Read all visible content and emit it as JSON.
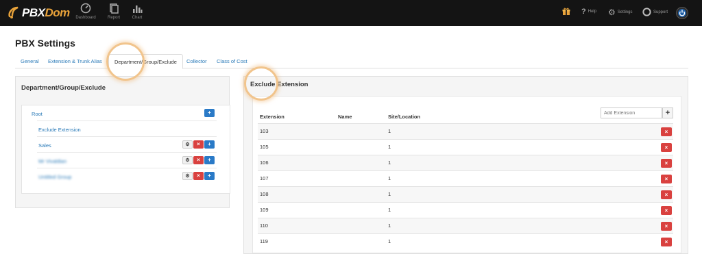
{
  "brand": {
    "prefix": "PBX",
    "suffix": "Dom"
  },
  "nav": {
    "dashboard": "Dashboard",
    "report": "Report",
    "chart": "Chart",
    "help": "Help",
    "settings": "Settings",
    "support": "Support"
  },
  "page_title": "PBX Settings",
  "tabs": [
    {
      "label": "General"
    },
    {
      "label": "Extension & Trunk Alias"
    },
    {
      "label": "Department/Group/Exclude",
      "active": true
    },
    {
      "label": "Collector"
    },
    {
      "label": "Class of Cost"
    }
  ],
  "left_panel": {
    "title": "Department/Group/Exclude",
    "tree": {
      "root": "Root",
      "children": [
        "Exclude Extension",
        "Sales",
        "Mr Vivaldian",
        "Untitled Group"
      ]
    }
  },
  "right_panel": {
    "title": "Exclude Extension",
    "columns": [
      "Extension",
      "Name",
      "Site/Location"
    ],
    "add_placeholder": "Add Extension",
    "rows": [
      {
        "extension": "103",
        "name": "",
        "site": "1"
      },
      {
        "extension": "105",
        "name": "",
        "site": "1"
      },
      {
        "extension": "106",
        "name": "",
        "site": "1"
      },
      {
        "extension": "107",
        "name": "",
        "site": "1"
      },
      {
        "extension": "108",
        "name": "",
        "site": "1"
      },
      {
        "extension": "109",
        "name": "",
        "site": "1"
      },
      {
        "extension": "110",
        "name": "",
        "site": "1"
      },
      {
        "extension": "119",
        "name": "",
        "site": "1"
      }
    ]
  },
  "glyphs": {
    "plus": "+",
    "times": "×",
    "gear": "⚙"
  },
  "colors": {
    "navbar": "#141414",
    "brand_accent": "#e8a23a",
    "link": "#2a7ab8",
    "primary": "#2a7ac7",
    "danger": "#d9413f"
  }
}
